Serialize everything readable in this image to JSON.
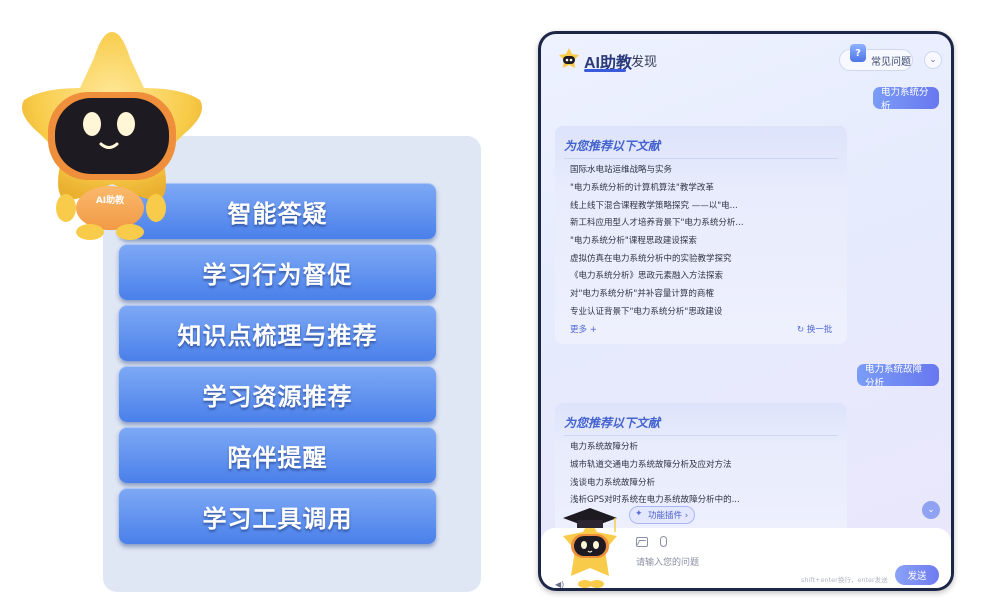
{
  "features": [
    "智能答疑",
    "学习行为督促",
    "知识点梳理与推荐",
    "学习资源推荐",
    "陪伴提醒",
    "学习工具调用"
  ],
  "mascot": {
    "badge": "AI助教"
  },
  "chat": {
    "app_name": "AI助教",
    "discover_tab": "发现",
    "faq_button": "常见问题",
    "faq_icon_glyph": "?",
    "collapse_glyph": "⌄",
    "messages": [
      {
        "user": "电力系统分析",
        "rec_title": "为您推荐以下文献",
        "items": [
          "国际水电站运维战略与实务",
          "\"电力系统分析的计算机算法\"教学改革",
          "线上线下混合课程教学策略探究 ——以\"电...",
          "新工科应用型人才培养背景下\"电力系统分析...",
          "\"电力系统分析\"课程思政建设探索",
          "虚拟仿真在电力系统分析中的实验教学探究",
          "《电力系统分析》思政元素融入方法探索",
          "对\"电力系统分析\"并补容量计算的商榷",
          "专业认证背景下\"电力系统分析\"思政建设"
        ],
        "more": "更多 +",
        "refresh": "换一批",
        "refresh_glyph": "↻"
      },
      {
        "user": "电力系统故障分析",
        "rec_title": "为您推荐以下文献",
        "items": [
          "电力系统故障分析",
          "城市轨道交通电力系统故障分析及应对方法",
          "浅谈电力系统故障分析",
          "浅析GPS对时系统在电力系统故障分析中的..."
        ]
      }
    ],
    "scroll_down_glyph": "⌄",
    "plugin_button": "功能插件 ›",
    "plugin_icon_glyph": "✦",
    "input_placeholder": "请输入您的问题",
    "shortcut_hint": "shift+enter换行，enter发送",
    "send_button": "发送",
    "speaker_glyph": "◀)"
  },
  "colors": {
    "feature_button": "#4a80ea",
    "accent": "#6878ef",
    "rec_title": "#4463cf",
    "panel_bg": "#dfe6f4",
    "mascot_yellow": "#f6c843"
  }
}
